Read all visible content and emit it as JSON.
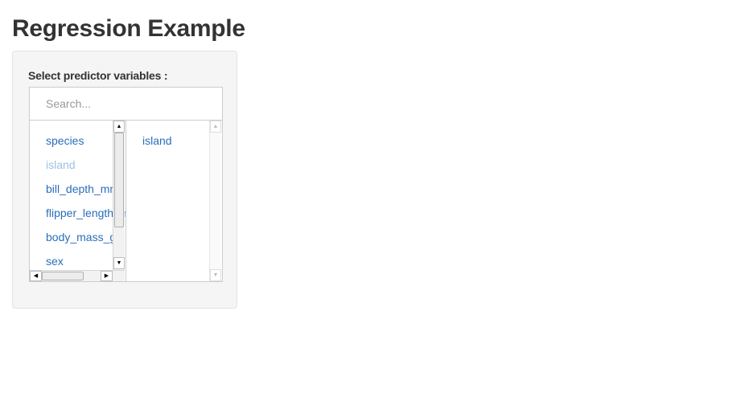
{
  "page": {
    "title": "Regression Example"
  },
  "selector": {
    "label": "Select predictor variables :",
    "search_placeholder": "Search...",
    "available": [
      {
        "label": "species",
        "disabled": false
      },
      {
        "label": "island",
        "disabled": true
      },
      {
        "label": "bill_depth_mm",
        "disabled": false
      },
      {
        "label": "flipper_length_mm",
        "disabled": false
      },
      {
        "label": "body_mass_g",
        "disabled": false
      },
      {
        "label": "sex",
        "disabled": false
      }
    ],
    "selected": [
      {
        "label": "island"
      }
    ]
  },
  "icons": {
    "up": "arrow-up-icon",
    "down": "arrow-down-icon",
    "left": "arrow-left-icon",
    "right": "arrow-right-icon"
  },
  "colors": {
    "item": "#2a6ebb",
    "item_disabled": "#9fc1e4",
    "panel_bg": "#f5f5f5"
  }
}
